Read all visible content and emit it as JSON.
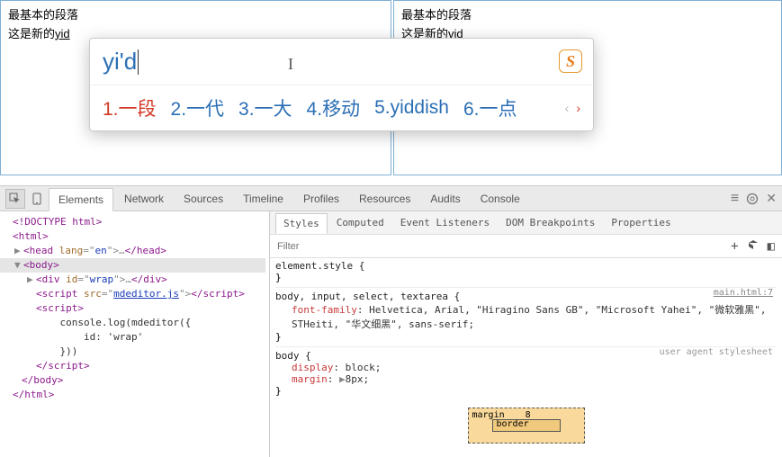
{
  "panes": {
    "left": {
      "line1": "最基本的段落",
      "line2_prefix": "这是新的",
      "line2_typed": "yid"
    },
    "right": {
      "line1": "最基本的段落",
      "line2": "这是新的vid"
    }
  },
  "ime": {
    "input": "yi'd",
    "candidates": [
      {
        "n": "1.",
        "w": "一段"
      },
      {
        "n": "2.",
        "w": "一代"
      },
      {
        "n": "3.",
        "w": "一大"
      },
      {
        "n": "4.",
        "w": "移动"
      },
      {
        "n": "5.",
        "w": "yiddish"
      },
      {
        "n": "6.",
        "w": "一点"
      }
    ],
    "logo": "S",
    "pager": {
      "prev": "‹",
      "next": "›"
    }
  },
  "devtools": {
    "tabs": [
      "Elements",
      "Network",
      "Sources",
      "Timeline",
      "Profiles",
      "Resources",
      "Audits",
      "Console"
    ],
    "active_tab": "Elements",
    "subtabs": [
      "Styles",
      "Computed",
      "Event Listeners",
      "DOM Breakpoints",
      "Properties"
    ],
    "active_subtab": "Styles",
    "filter_placeholder": "Filter",
    "dom": {
      "l0": "<!DOCTYPE html>",
      "l1": "<html>",
      "l2a": "<head ",
      "l2b": "lang",
      "l2c": "=\"",
      "l2d": "en",
      "l2e": "\">",
      "l2f": "…",
      "l2g": "</head>",
      "l3": "<body>",
      "l4a": "<div ",
      "l4b": "id",
      "l4c": "=\"",
      "l4d": "wrap",
      "l4e": "\">",
      "l4f": "…",
      "l4g": "</div>",
      "l5a": "<script ",
      "l5b": "src",
      "l5c": "=\"",
      "l5d": "mdeditor.js",
      "l5e": "\">",
      "l5f": "</script>",
      "l6": "<script>",
      "l7": "    console.log(mdeditor({",
      "l8": "        id: 'wrap'",
      "l9": "    }))",
      "l10": "</script>",
      "l11": "</body>",
      "l12": "</html>"
    },
    "styles": {
      "elstyle": "element.style {",
      "close": "}",
      "r1_sel": "body, input, select, textarea {",
      "r1_src": "main.html:7",
      "r1_prop": "font-family",
      "r1_val": ": Helvetica, Arial, \"Hiragino Sans GB\", \"Microsoft Yahei\", \"微软雅黑\", STHeiti, \"华文细黑\", sans-serif;",
      "r2_sel": "body {",
      "r2_note": "user agent stylesheet",
      "r2_p1": "display",
      "r2_v1": ": block;",
      "r2_p2": "margin",
      "r2_v2": ": ",
      "r2_tri": "▶",
      "r2_v2b": "8px;"
    },
    "boxmodel": {
      "margin_label": "margin",
      "margin_val": "8",
      "border_label": "border"
    }
  }
}
